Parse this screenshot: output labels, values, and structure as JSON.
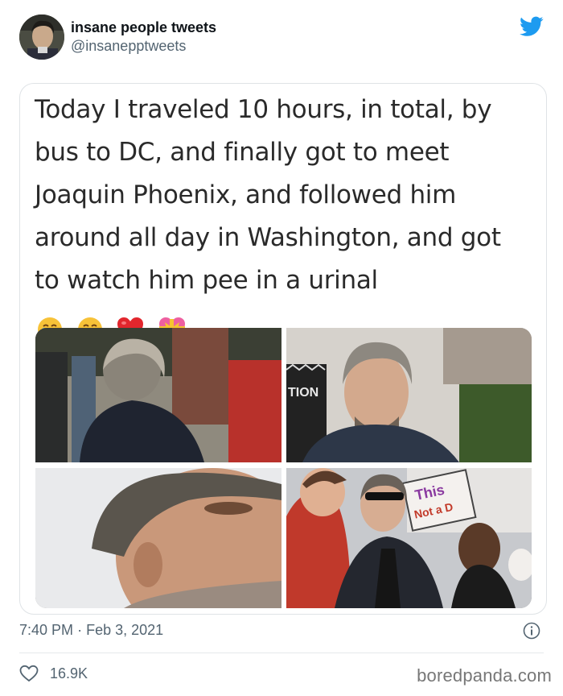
{
  "account": {
    "display_name": "insane people tweets",
    "handle": "@insanepptweets",
    "avatar_icon": "profile-avatar",
    "platform_icon": "twitter-bird-icon",
    "brand_color": "#1d9bf0"
  },
  "tweet": {
    "lines": [
      "Today I traveled 10 hours, in total, by",
      "bus to DC, and finally got to meet",
      "Joaquin Phoenix, and followed him",
      "around all day in Washington, and got",
      "to watch him pee in a urinal"
    ],
    "emojis": [
      "crying-face-emoji",
      "crying-face-emoji",
      "red-heart-emoji",
      "heart-with-ribbon-emoji"
    ],
    "photo_signs": {
      "banner_text": "TION",
      "sign_line_1": "This",
      "sign_line_2": "Not a D"
    }
  },
  "meta": {
    "time": "7:40 PM",
    "separator": "·",
    "date": "Feb 3, 2021"
  },
  "engagement": {
    "likes": "16.9K"
  },
  "watermark": "boredpanda.com"
}
